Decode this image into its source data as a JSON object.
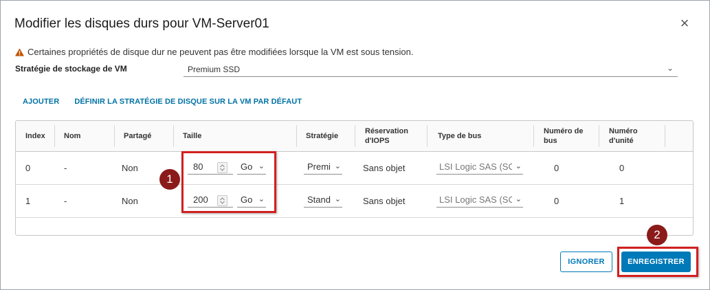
{
  "dialog": {
    "title": "Modifier les disques durs pour VM-Server01",
    "close_label": "×",
    "warning": "Certaines propriétés de disque dur ne peuvent pas être modifiées lorsque la VM est sous tension.",
    "warning_icon": "warning-triangle-icon",
    "warning_color": "#c25400"
  },
  "policy": {
    "label": "Stratégie de stockage de VM",
    "value": "Premium SSD"
  },
  "actions": {
    "add": "AJOUTER",
    "set_default": "DÉFINIR LA STRATÉGIE DE DISQUE SUR LA VM PAR DÉFAUT"
  },
  "table": {
    "headers": {
      "index": "Index",
      "name": "Nom",
      "shared": "Partagé",
      "size": "Taille",
      "strategy": "Stratégie",
      "iops_line1": "Réservation",
      "iops_line2": "d'IOPS",
      "bus_type": "Type de bus",
      "bus_num_line1": "Numéro de",
      "bus_num_line2": "bus",
      "unit_num_line1": "Numéro",
      "unit_num_line2": "d'unité"
    },
    "rows": [
      {
        "index": "0",
        "name": "-",
        "shared": "Non",
        "size": "80",
        "unit": "Go",
        "strategy": "Premi",
        "iops": "Sans objet",
        "bus_type": "LSI Logic SAS (SCSI)",
        "bus_number": "0",
        "unit_number": "0"
      },
      {
        "index": "1",
        "name": "-",
        "shared": "Non",
        "size": "200",
        "unit": "Go",
        "strategy": "Stand",
        "iops": "Sans objet",
        "bus_type": "LSI Logic SAS (SCSI)",
        "bus_number": "0",
        "unit_number": "1"
      }
    ]
  },
  "annotations": {
    "badge1": "1",
    "badge2": "2",
    "highlight_color": "#d21f1f",
    "badge_color": "#8b1a1a"
  },
  "buttons": {
    "ignore": "IGNORER",
    "save": "ENREGISTRER"
  },
  "colors": {
    "accent": "#0079b8",
    "link": "#0072a3"
  }
}
